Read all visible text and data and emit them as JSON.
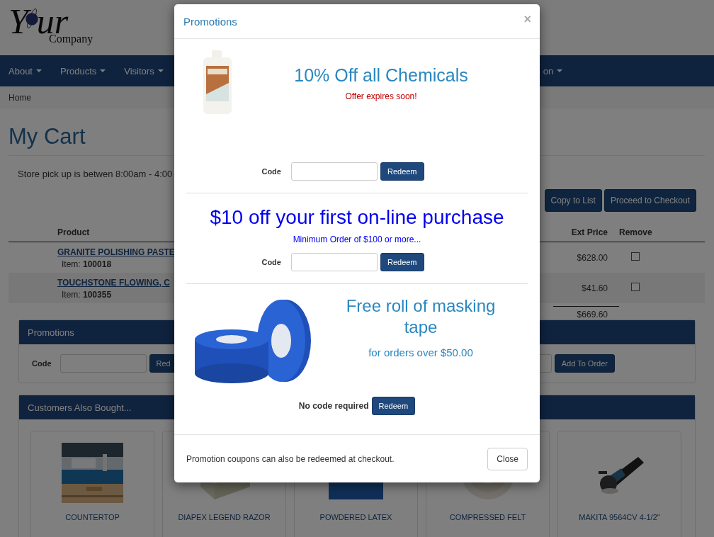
{
  "logo": {
    "first_letter": "Y",
    "rest": "ur",
    "second_line": "Company"
  },
  "nav": [
    {
      "label": "About"
    },
    {
      "label": "Products"
    },
    {
      "label": "Visitors"
    },
    {
      "label": "on"
    }
  ],
  "breadcrumb": [
    "Home"
  ],
  "page_title": "My Cart",
  "pickup_note": "Store pick up is betwen 8:00am - 4:00",
  "cart_buttons": [
    "Copy to List",
    "Proceed to Checkout"
  ],
  "cart_table": {
    "columns": [
      "Product",
      "Ext Price",
      "Remove"
    ],
    "rows": [
      {
        "product": "GRANITE POLISHING PASTE",
        "item_label": "Item:",
        "item_number": "100018",
        "ext_price": "$628.00",
        "remove_checked": false
      },
      {
        "product": "TOUCHSTONE FLOWING, C",
        "item_label": "Item:",
        "item_number": "100355",
        "ext_price": "$41.60",
        "remove_checked": false
      }
    ],
    "total": "$669.60"
  },
  "promotions_panel": {
    "title": "Promotions",
    "code_label": "Code",
    "redeem_button": "Red",
    "add_button": "Add To Order"
  },
  "also_bought": {
    "title": "Customers Also Bought...",
    "products": [
      {
        "name": "COUNTERTOP"
      },
      {
        "name": "DIAPEX LEGEND RAZOR"
      },
      {
        "name": "POWDERED LATEX"
      },
      {
        "name": "COMPRESSED FELT"
      },
      {
        "name": "MAKITA 9564CV 4-1/2\""
      }
    ]
  },
  "modal": {
    "title": "Promotions",
    "close_icon": "×",
    "offers": [
      {
        "kind": "image_alert",
        "title": "10% Off all Chemicals",
        "subtitle": "Offer expires soon!",
        "code_label": "Code",
        "has_code_field": true,
        "button": "Redeem"
      },
      {
        "kind": "text_only",
        "title": "$10 off your first on-line purchase",
        "subtitle": "Minimum Order of $100 or more...",
        "code_label": "Code",
        "has_code_field": true,
        "button": "Redeem"
      },
      {
        "kind": "image_tall",
        "title": "Free roll of masking tape",
        "subtitle": "for orders over $50.00",
        "code_label": "No code required",
        "has_code_field": false,
        "button": "Redeem"
      }
    ],
    "footer_note": "Promotion coupons can also be redeemed at checkout.",
    "close_button": "Close"
  }
}
